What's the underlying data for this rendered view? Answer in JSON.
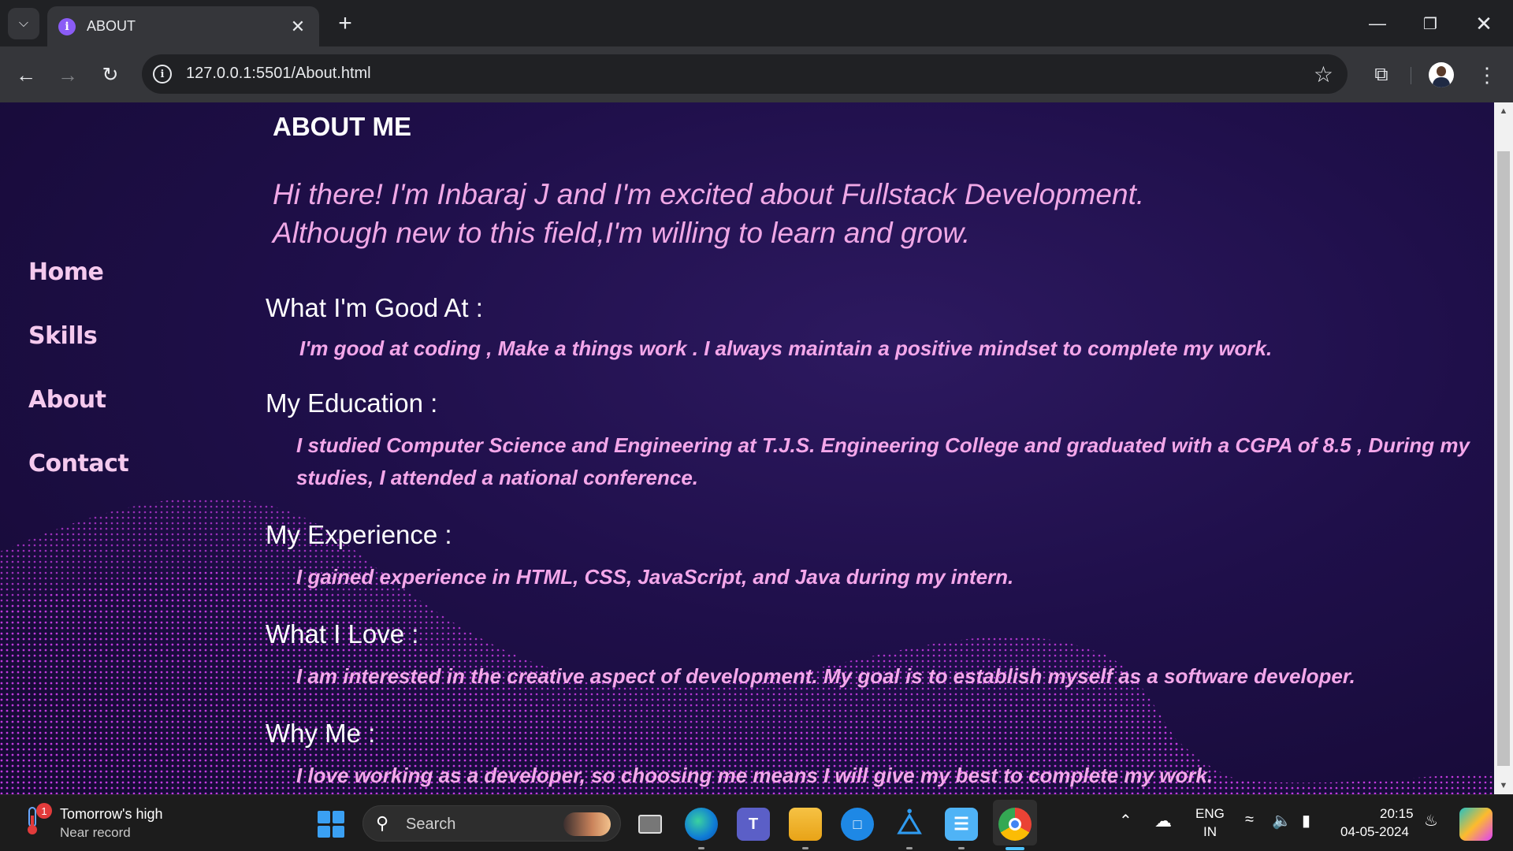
{
  "browser": {
    "tab_title": "ABOUT",
    "url": "127.0.0.1:5501/About.html",
    "tab_close": "✕",
    "new_tab": "+"
  },
  "page": {
    "nav": [
      "Home",
      "Skills",
      "About",
      "Contact"
    ],
    "title": "ABOUT ME",
    "intro_line1": "Hi there! I'm Inbaraj J and I'm excited about Fullstack Development.",
    "intro_line2": "Although new to this field,I'm willing to learn and grow.",
    "sections": [
      {
        "heading": "What I'm Good At :",
        "body_lines": [
          "I'm good at coding , Make a things work . I always maintain a positive mindset to complete my work."
        ]
      },
      {
        "heading": "My Education :",
        "body_lines": [
          "I studied Computer Science and Engineering at T.J.S. Engineering College and graduated with a CGPA of 8.5 , During my",
          "studies, I attended a national conference."
        ]
      },
      {
        "heading": "My Experience :",
        "body_lines": [
          "I gained experience in HTML, CSS, JavaScript, and Java during my intern."
        ]
      },
      {
        "heading": "What I Love :",
        "body_lines": [
          "I am interested in the creative aspect of development. My goal is to establish myself as a software developer."
        ]
      },
      {
        "heading": "Why Me :",
        "body_lines": [
          "I love working as a developer, so choosing me means I will give my best to complete my work."
        ]
      }
    ]
  },
  "taskbar": {
    "weather_line1": "Tomorrow's high",
    "weather_line2": "Near record",
    "weather_badge": "1",
    "search_label": "Search",
    "lang_line1": "ENG",
    "lang_line2": "IN",
    "time": "20:15",
    "date": "04-05-2024"
  },
  "colors": {
    "page_bg": "#1f0f4a",
    "nav_text": "#f5c9ee",
    "intro_text": "#f0a8e6",
    "body_text": "#f4a7ea",
    "dots": "#c43ae0"
  }
}
